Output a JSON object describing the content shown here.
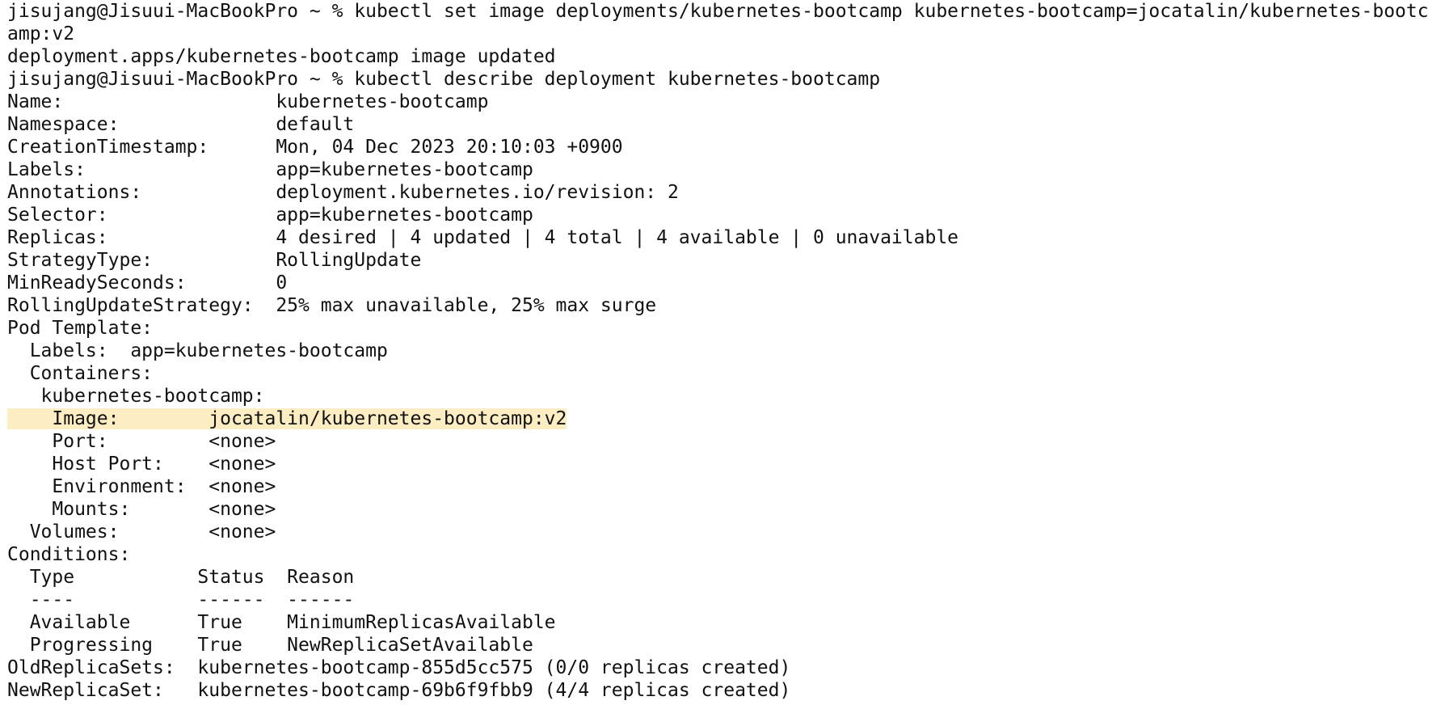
{
  "terminal": {
    "lines": [
      "jisujang@Jisuui-MacBookPro ~ % kubectl set image deployments/kubernetes-bootcamp kubernetes-bootcamp=jocatalin/kubernetes-bootc",
      "amp:v2",
      "deployment.apps/kubernetes-bootcamp image updated",
      "jisujang@Jisuui-MacBookPro ~ % kubectl describe deployment kubernetes-bootcamp",
      "Name:                   kubernetes-bootcamp",
      "Namespace:              default",
      "CreationTimestamp:      Mon, 04 Dec 2023 20:10:03 +0900",
      "Labels:                 app=kubernetes-bootcamp",
      "Annotations:            deployment.kubernetes.io/revision: 2",
      "Selector:               app=kubernetes-bootcamp",
      "Replicas:               4 desired | 4 updated | 4 total | 4 available | 0 unavailable",
      "StrategyType:           RollingUpdate",
      "MinReadySeconds:        0",
      "RollingUpdateStrategy:  25% max unavailable, 25% max surge",
      "Pod Template:",
      "  Labels:  app=kubernetes-bootcamp",
      "  Containers:",
      "   kubernetes-bootcamp:",
      "    Image:        jocatalin/kubernetes-bootcamp:v2",
      "    Port:         <none>",
      "    Host Port:    <none>",
      "    Environment:  <none>",
      "    Mounts:       <none>",
      "  Volumes:        <none>",
      "Conditions:",
      "  Type           Status  Reason",
      "  ----           ------  ------",
      "  Available      True    MinimumReplicasAvailable",
      "  Progressing    True    NewReplicaSetAvailable",
      "OldReplicaSets:  kubernetes-bootcamp-855d5cc575 (0/0 replicas created)",
      "NewReplicaSet:   kubernetes-bootcamp-69b6f9fbb9 (4/4 replicas created)"
    ],
    "highlight_color": "#fcedc2",
    "text_color": "#111111",
    "background_color": "#ffffff"
  }
}
